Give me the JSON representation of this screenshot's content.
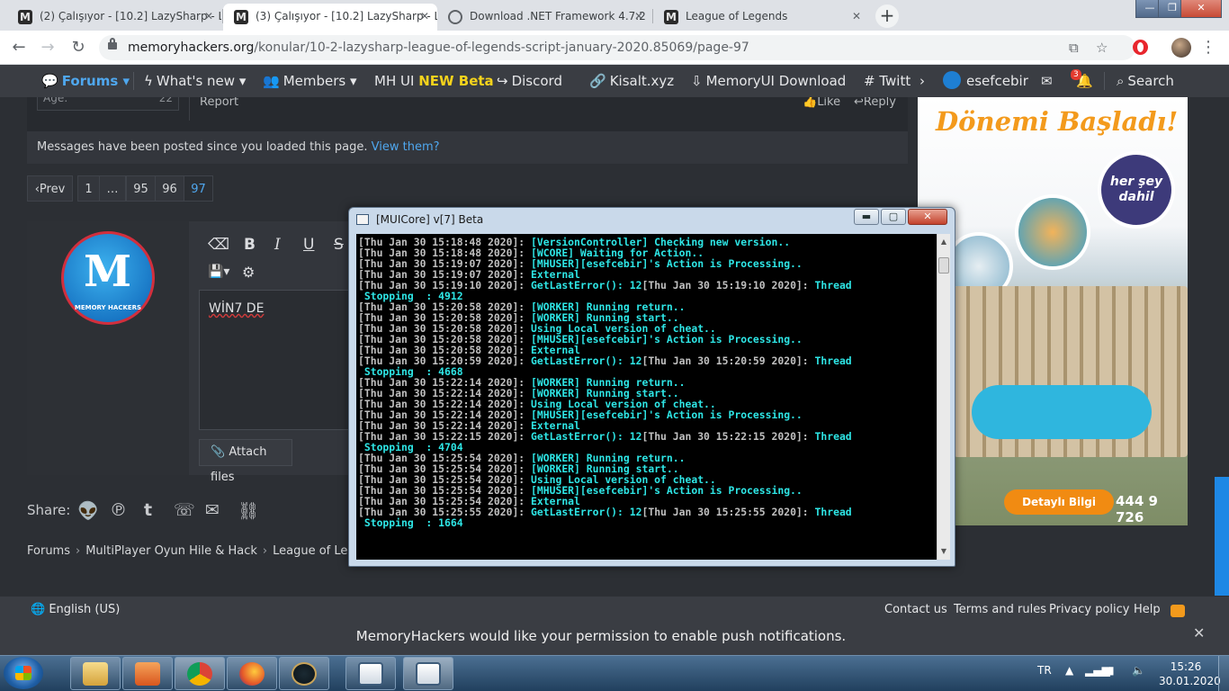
{
  "browser": {
    "tabs": [
      {
        "title": "(2) Çalışıyor - [10.2] LazySharp - L"
      },
      {
        "title": "(3) Çalışıyor - [10.2] LazySharp - L"
      },
      {
        "title": "Download .NET Framework 4.7.2"
      },
      {
        "title": "League of Legends"
      }
    ],
    "url_host": "memoryhackers.org",
    "url_path": "/konular/10-2-lazysharp-league-of-legends-script-january-2020.85069/page-97"
  },
  "nav": {
    "forums": "Forums",
    "whats_new": "What's new",
    "members": "Members",
    "mh_ui": "MH UI",
    "new_beta": "NEW Beta",
    "discord": "Discord",
    "kisalt": "Kisalt.xyz",
    "memoryui_download": "MemoryUI Download",
    "twitter": "# Twitt",
    "username": "esefcebir",
    "alert_count": "3",
    "search": "Search"
  },
  "post": {
    "age_label": "Age:",
    "age_value": "22",
    "report": "Report",
    "like": "Like",
    "reply": "Reply"
  },
  "notice": {
    "text": "Messages have been posted since you loaded this page.",
    "link": "View them?"
  },
  "pagination": {
    "prev": "Prev",
    "pages": [
      "1",
      "…",
      "95",
      "96",
      "97"
    ]
  },
  "editor": {
    "logo_text": "MEMORY HACKERS",
    "content": "WİN7 DE",
    "attach": "Attach files"
  },
  "share": {
    "label": "Share:"
  },
  "breadcrumb": [
    "Forums",
    "MultiPlayer Oyun Hile & Hack",
    "League of Legends"
  ],
  "ad": {
    "headline": "Dönemi Başladı!",
    "badge": "her şey dahil",
    "cta": "Detaylı Bilgi",
    "phone": "444 9 726"
  },
  "footer": {
    "language": "English (US)",
    "contact": "Contact us",
    "terms": "Terms and rules",
    "privacy": "Privacy policy",
    "help": "Help",
    "push_message": "MemoryHackers would like your permission to enable push notifications."
  },
  "console": {
    "title": "[MUICore] v[7] Beta",
    "lines": [
      {
        "ts": "[Thu Jan 30 15:18:48 2020]: ",
        "msg": "[VersionController] Checking new version.."
      },
      {
        "ts": "[Thu Jan 30 15:18:48 2020]: ",
        "msg": "[WCORE] Waiting for Action.."
      },
      {
        "ts": "[Thu Jan 30 15:19:07 2020]: ",
        "msg": "[MHUSER][esefcebir]'s Action is Processing.."
      },
      {
        "ts": "[Thu Jan 30 15:19:07 2020]: ",
        "msg": "External"
      },
      {
        "ts": "[Thu Jan 30 15:19:10 2020]: ",
        "msg": "GetLastError(): 12",
        "tail": "[Thu Jan 30 15:19:10 2020]: ",
        "tail2": "Thread"
      },
      {
        "ts": "",
        "msg": " Stopping  : 4912"
      },
      {
        "ts": "[Thu Jan 30 15:20:58 2020]: ",
        "msg": "[WORKER] Running return.."
      },
      {
        "ts": "[Thu Jan 30 15:20:58 2020]: ",
        "msg": "[WORKER] Running start.."
      },
      {
        "ts": "[Thu Jan 30 15:20:58 2020]: ",
        "msg": "Using Local version of cheat.."
      },
      {
        "ts": "[Thu Jan 30 15:20:58 2020]: ",
        "msg": "[MHUSER][esefcebir]'s Action is Processing.."
      },
      {
        "ts": "[Thu Jan 30 15:20:58 2020]: ",
        "msg": "External"
      },
      {
        "ts": "[Thu Jan 30 15:20:59 2020]: ",
        "msg": "GetLastError(): 12",
        "tail": "[Thu Jan 30 15:20:59 2020]: ",
        "tail2": "Thread"
      },
      {
        "ts": "",
        "msg": " Stopping  : 4668"
      },
      {
        "ts": "[Thu Jan 30 15:22:14 2020]: ",
        "msg": "[WORKER] Running return.."
      },
      {
        "ts": "[Thu Jan 30 15:22:14 2020]: ",
        "msg": "[WORKER] Running start.."
      },
      {
        "ts": "[Thu Jan 30 15:22:14 2020]: ",
        "msg": "Using Local version of cheat.."
      },
      {
        "ts": "[Thu Jan 30 15:22:14 2020]: ",
        "msg": "[MHUSER][esefcebir]'s Action is Processing.."
      },
      {
        "ts": "[Thu Jan 30 15:22:14 2020]: ",
        "msg": "External"
      },
      {
        "ts": "[Thu Jan 30 15:22:15 2020]: ",
        "msg": "GetLastError(): 12",
        "tail": "[Thu Jan 30 15:22:15 2020]: ",
        "tail2": "Thread"
      },
      {
        "ts": "",
        "msg": " Stopping  : 4704"
      },
      {
        "ts": "[Thu Jan 30 15:25:54 2020]: ",
        "msg": "[WORKER] Running return.."
      },
      {
        "ts": "[Thu Jan 30 15:25:54 2020]: ",
        "msg": "[WORKER] Running start.."
      },
      {
        "ts": "[Thu Jan 30 15:25:54 2020]: ",
        "msg": "Using Local version of cheat.."
      },
      {
        "ts": "[Thu Jan 30 15:25:54 2020]: ",
        "msg": "[MHUSER][esefcebir]'s Action is Processing.."
      },
      {
        "ts": "[Thu Jan 30 15:25:54 2020]: ",
        "msg": "External"
      },
      {
        "ts": "[Thu Jan 30 15:25:55 2020]: ",
        "msg": "GetLastError(): 12",
        "tail": "[Thu Jan 30 15:25:55 2020]: ",
        "tail2": "Thread"
      },
      {
        "ts": "",
        "msg": " Stopping  : 1664"
      }
    ]
  },
  "taskbar": {
    "lang": "TR",
    "time": "15:26",
    "date": "30.01.2020"
  },
  "colors": {
    "accent_link": "#4fa7ee",
    "console_text": "#2ee6e6",
    "ad_orange": "#f39a1c"
  }
}
